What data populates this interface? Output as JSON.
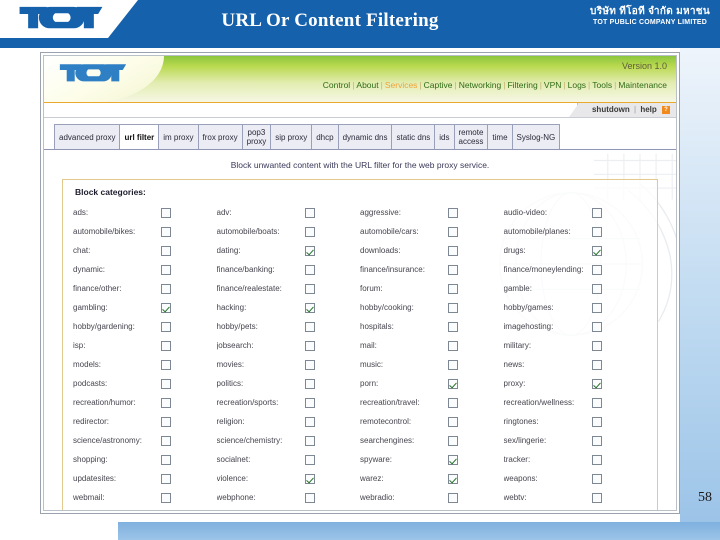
{
  "slide": {
    "title": "URL Or Content Filtering",
    "page_number": "58",
    "brand": {
      "logo_text": "TOT",
      "corp_thai": "บริษัท ทีโอที จำกัด มหาชน",
      "corp_english": "TOT PUBLIC COMPANY LIMITED"
    }
  },
  "app": {
    "logo_text": "TOT",
    "version": "Version 1.0",
    "nav": [
      {
        "label": "Control",
        "active": false
      },
      {
        "label": "About",
        "active": false
      },
      {
        "label": "Services",
        "active": true
      },
      {
        "label": "Captive",
        "active": false
      },
      {
        "label": "Networking",
        "active": false
      },
      {
        "label": "Filtering",
        "active": false
      },
      {
        "label": "VPN",
        "active": false
      },
      {
        "label": "Logs",
        "active": false
      },
      {
        "label": "Tools",
        "active": false
      },
      {
        "label": "Maintenance",
        "active": false
      }
    ],
    "util": {
      "shutdown": "shutdown",
      "help": "help",
      "separator": "|",
      "help_icon": "?"
    },
    "tabs": [
      {
        "label": "advanced proxy",
        "active": false
      },
      {
        "label": "url filter",
        "active": true
      },
      {
        "label": "im proxy",
        "active": false
      },
      {
        "label": "frox proxy",
        "active": false
      },
      {
        "label": "pop3\nproxy",
        "active": false
      },
      {
        "label": "sip proxy",
        "active": false
      },
      {
        "label": "dhcp",
        "active": false
      },
      {
        "label": "dynamic dns",
        "active": false
      },
      {
        "label": "static dns",
        "active": false
      },
      {
        "label": "ids",
        "active": false
      },
      {
        "label": "remote\naccess",
        "active": false
      },
      {
        "label": "time",
        "active": false
      },
      {
        "label": "Syslog-NG",
        "active": false
      }
    ],
    "subtitle": "Block unwanted content with the URL filter for the web proxy service.",
    "panel": {
      "title": "Block categories:",
      "categories": [
        {
          "label": "ads:",
          "checked": false
        },
        {
          "label": "adv:",
          "checked": false
        },
        {
          "label": "aggressive:",
          "checked": false
        },
        {
          "label": "audio-video:",
          "checked": false
        },
        {
          "label": "automobile/bikes:",
          "checked": false
        },
        {
          "label": "automobile/boats:",
          "checked": false
        },
        {
          "label": "automobile/cars:",
          "checked": false
        },
        {
          "label": "automobile/planes:",
          "checked": false
        },
        {
          "label": "chat:",
          "checked": false
        },
        {
          "label": "dating:",
          "checked": true
        },
        {
          "label": "downloads:",
          "checked": false
        },
        {
          "label": "drugs:",
          "checked": true
        },
        {
          "label": "dynamic:",
          "checked": false
        },
        {
          "label": "finance/banking:",
          "checked": false
        },
        {
          "label": "finance/insurance:",
          "checked": false
        },
        {
          "label": "finance/moneylending:",
          "checked": false
        },
        {
          "label": "finance/other:",
          "checked": false
        },
        {
          "label": "finance/realestate:",
          "checked": false
        },
        {
          "label": "forum:",
          "checked": false
        },
        {
          "label": "gamble:",
          "checked": false
        },
        {
          "label": "gambling:",
          "checked": true
        },
        {
          "label": "hacking:",
          "checked": true
        },
        {
          "label": "hobby/cooking:",
          "checked": false
        },
        {
          "label": "hobby/games:",
          "checked": false
        },
        {
          "label": "hobby/gardening:",
          "checked": false
        },
        {
          "label": "hobby/pets:",
          "checked": false
        },
        {
          "label": "hospitals:",
          "checked": false
        },
        {
          "label": "imagehosting:",
          "checked": false
        },
        {
          "label": "isp:",
          "checked": false
        },
        {
          "label": "jobsearch:",
          "checked": false
        },
        {
          "label": "mail:",
          "checked": false
        },
        {
          "label": "military:",
          "checked": false
        },
        {
          "label": "models:",
          "checked": false
        },
        {
          "label": "movies:",
          "checked": false
        },
        {
          "label": "music:",
          "checked": false
        },
        {
          "label": "news:",
          "checked": false
        },
        {
          "label": "podcasts:",
          "checked": false
        },
        {
          "label": "politics:",
          "checked": false
        },
        {
          "label": "porn:",
          "checked": true
        },
        {
          "label": "proxy:",
          "checked": true
        },
        {
          "label": "recreation/humor:",
          "checked": false
        },
        {
          "label": "recreation/sports:",
          "checked": false
        },
        {
          "label": "recreation/travel:",
          "checked": false
        },
        {
          "label": "recreation/wellness:",
          "checked": false
        },
        {
          "label": "redirector:",
          "checked": false
        },
        {
          "label": "religion:",
          "checked": false
        },
        {
          "label": "remotecontrol:",
          "checked": false
        },
        {
          "label": "ringtones:",
          "checked": false
        },
        {
          "label": "science/astronomy:",
          "checked": false
        },
        {
          "label": "science/chemistry:",
          "checked": false
        },
        {
          "label": "searchengines:",
          "checked": false
        },
        {
          "label": "sex/lingerie:",
          "checked": false
        },
        {
          "label": "shopping:",
          "checked": false
        },
        {
          "label": "socialnet:",
          "checked": false
        },
        {
          "label": "spyware:",
          "checked": true
        },
        {
          "label": "tracker:",
          "checked": false
        },
        {
          "label": "updatesites:",
          "checked": false
        },
        {
          "label": "violence:",
          "checked": true
        },
        {
          "label": "warez:",
          "checked": true
        },
        {
          "label": "weapons:",
          "checked": false
        },
        {
          "label": "webmail:",
          "checked": false
        },
        {
          "label": "webphone:",
          "checked": false
        },
        {
          "label": "webradio:",
          "checked": false
        },
        {
          "label": "webtv:",
          "checked": false
        }
      ]
    }
  },
  "colors": {
    "slide_header_blue": "#1561ac",
    "banner_green": "#8cc63e",
    "accent_orange": "#f0a33a",
    "check_green": "#27742b",
    "panel_border": "#e3c98d"
  }
}
